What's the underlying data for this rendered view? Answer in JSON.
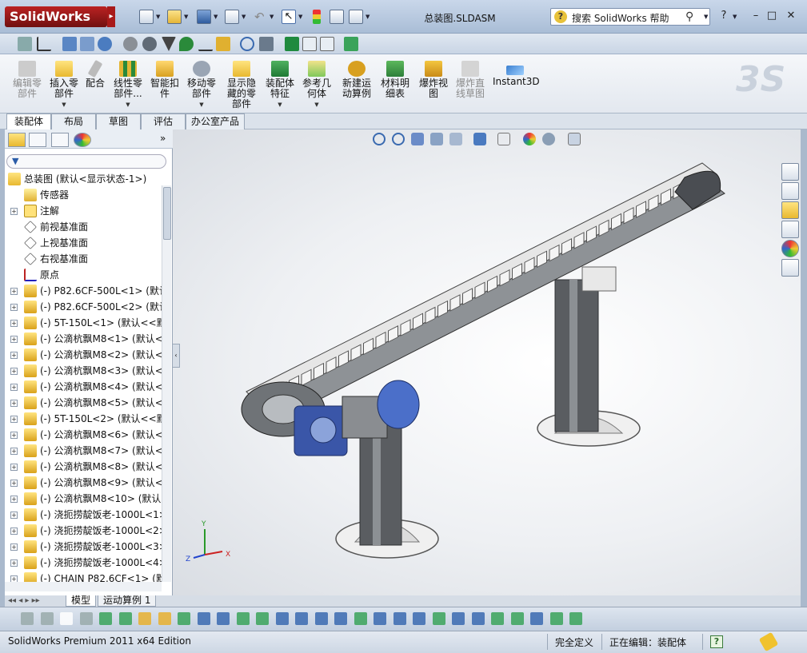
{
  "app": {
    "logo_text": "SolidWorks",
    "document_title": "总装图.SLDASM",
    "help_search_placeholder": "搜索 SolidWorks 帮助",
    "help_icon": "?",
    "window_controls": [
      "minimize-icon",
      "restore-icon",
      "close-icon"
    ],
    "brand_color": "#b01c1c"
  },
  "command_manager": {
    "buttons": [
      {
        "label": "编辑零\n部件",
        "enabled": false
      },
      {
        "label": "插入零\n部件",
        "enabled": true
      },
      {
        "label": "配合",
        "enabled": true
      },
      {
        "label": "线性零\n部件...",
        "enabled": true
      },
      {
        "label": "智能扣\n件",
        "enabled": true
      },
      {
        "label": "移动零\n部件",
        "enabled": true
      },
      {
        "label": "显示隐\n藏的零\n部件",
        "enabled": true
      },
      {
        "label": "装配体\n特征",
        "enabled": true
      },
      {
        "label": "参考几\n何体",
        "enabled": true
      },
      {
        "label": "新建运\n动算例",
        "enabled": true
      },
      {
        "label": "材料明\n细表",
        "enabled": true
      },
      {
        "label": "爆炸视\n图",
        "enabled": true
      },
      {
        "label": "爆炸直\n线草图",
        "enabled": false
      },
      {
        "label": "Instant3D",
        "enabled": true
      }
    ]
  },
  "tabs": {
    "items": [
      {
        "label": "装配体",
        "active": true
      },
      {
        "label": "布局",
        "active": false
      },
      {
        "label": "草图",
        "active": false
      },
      {
        "label": "评估",
        "active": false
      },
      {
        "label": "办公室产品",
        "active": false
      }
    ]
  },
  "feature_tree": {
    "root": "总装图  (默认<显示状态-1>)",
    "items": [
      {
        "label": "传感器",
        "expandable": false,
        "icon": "sensor-icon"
      },
      {
        "label": "注解",
        "expandable": true,
        "icon": "annotation-icon"
      },
      {
        "label": "前视基准面",
        "expandable": false,
        "icon": "plane-icon"
      },
      {
        "label": "上视基准面",
        "expandable": false,
        "icon": "plane-icon"
      },
      {
        "label": "右视基准面",
        "expandable": false,
        "icon": "plane-icon"
      },
      {
        "label": "原点",
        "expandable": false,
        "icon": "origin-icon"
      },
      {
        "label": "(-) P82.6CF-500L<1>  (默认",
        "expandable": true,
        "icon": "part-icon"
      },
      {
        "label": "(-) P82.6CF-500L<2>  (默认",
        "expandable": true,
        "icon": "part-icon"
      },
      {
        "label": "(-) 5T-150L<1>  (默认<<默",
        "expandable": true,
        "icon": "part-icon"
      },
      {
        "label": "(-) 公滴杭飘M8<1>  (默认<",
        "expandable": true,
        "icon": "part-icon"
      },
      {
        "label": "(-) 公滴杭飘M8<2>  (默认<",
        "expandable": true,
        "icon": "part-icon"
      },
      {
        "label": "(-) 公滴杭飘M8<3>  (默认<",
        "expandable": true,
        "icon": "part-icon"
      },
      {
        "label": "(-) 公滴杭飘M8<4>  (默认<",
        "expandable": true,
        "icon": "part-icon"
      },
      {
        "label": "(-) 公滴杭飘M8<5>  (默认<",
        "expandable": true,
        "icon": "part-icon"
      },
      {
        "label": "(-) 5T-150L<2>  (默认<<默",
        "expandable": true,
        "icon": "part-icon"
      },
      {
        "label": "(-) 公滴杭飘M8<6>  (默认<",
        "expandable": true,
        "icon": "part-icon"
      },
      {
        "label": "(-) 公滴杭飘M8<7>  (默认<",
        "expandable": true,
        "icon": "part-icon"
      },
      {
        "label": "(-) 公滴杭飘M8<8>  (默认<",
        "expandable": true,
        "icon": "part-icon"
      },
      {
        "label": "(-) 公滴杭飘M8<9>  (默认<",
        "expandable": true,
        "icon": "part-icon"
      },
      {
        "label": "(-) 公滴杭飘M8<10>  (默认",
        "expandable": true,
        "icon": "part-icon"
      },
      {
        "label": "(-) 浇扼捞靛饭老-1000L<1>",
        "expandable": true,
        "icon": "part-icon"
      },
      {
        "label": "(-) 浇扼捞靛饭老-1000L<2>",
        "expandable": true,
        "icon": "part-icon"
      },
      {
        "label": "(-) 浇扼捞靛饭老-1000L<3>",
        "expandable": true,
        "icon": "part-icon"
      },
      {
        "label": "(-) 浇扼捞靛饭老-1000L<4>",
        "expandable": true,
        "icon": "part-icon"
      },
      {
        "label": "(-) CHAIN P82.6CF<1>  (默",
        "expandable": true,
        "icon": "part-icon"
      }
    ]
  },
  "bottom_tabs": [
    {
      "label": "模型",
      "active": true
    },
    {
      "label": "运动算例 1",
      "active": false
    }
  ],
  "status_bar": {
    "edition": "SolidWorks Premium 2011 x64 Edition",
    "definition": "完全定义",
    "editing": "正在编辑：装配体",
    "help_icon": "?"
  },
  "axes_triad": {
    "x": "X",
    "y": "Y",
    "z": "Z"
  }
}
